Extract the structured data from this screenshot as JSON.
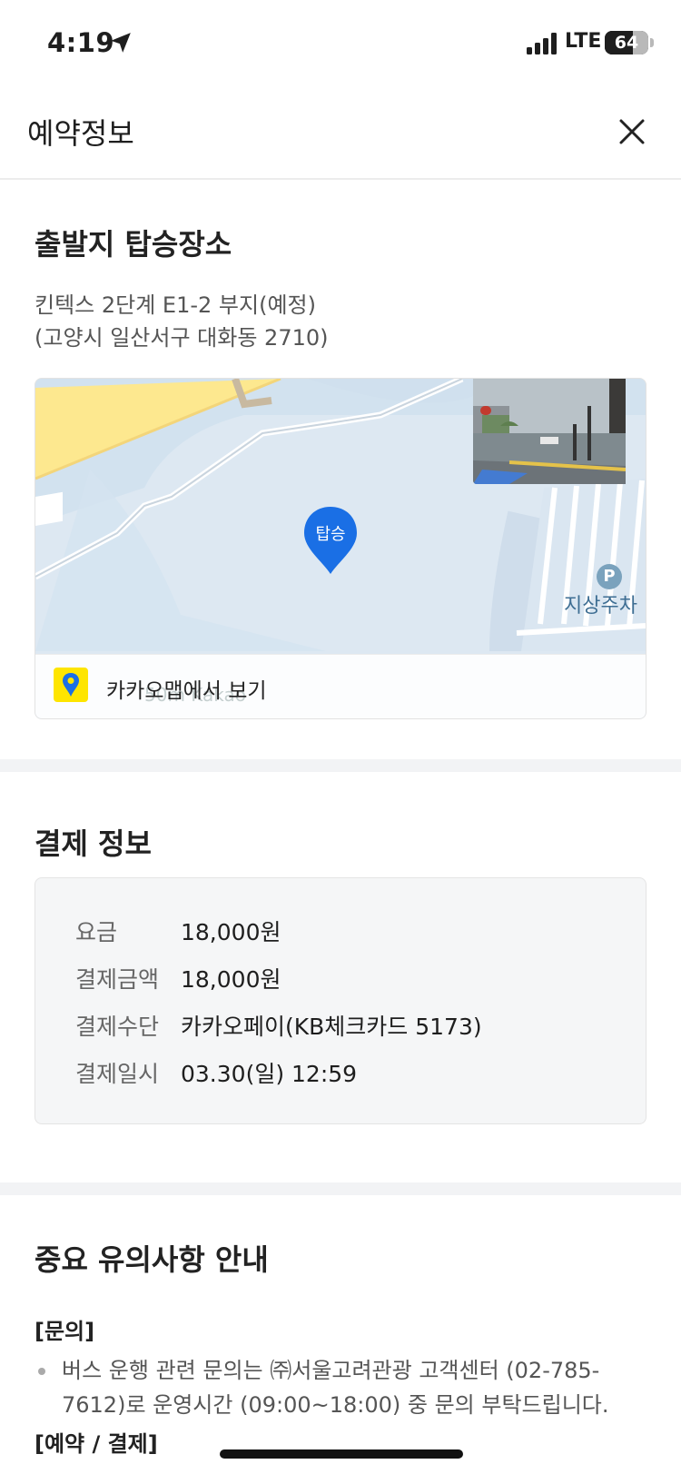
{
  "status_bar": {
    "time": "4:19",
    "network": "LTE",
    "battery": "64",
    "battery_level": 0.64
  },
  "header": {
    "title": "예약정보"
  },
  "departure": {
    "title": "출발지 탑승장소",
    "address_line1": "킨텍스 2단계 E1-2 부지(예정)",
    "address_line2": "(고양시 일산서구 대화동 2710)"
  },
  "map": {
    "pin_label": "탑승",
    "parking_label": "지상주차",
    "parking_symbol": "P",
    "open_link_label": "카카오맵에서 보기",
    "scale_text": "50m  Kakao"
  },
  "payment": {
    "title": "결제 정보",
    "rows": [
      {
        "key": "요금",
        "value": "18,000원"
      },
      {
        "key": "결제금액",
        "value": "18,000원"
      },
      {
        "key": "결제수단",
        "value": "카카오페이(KB체크카드 5173)"
      },
      {
        "key": "결제일시",
        "value": "03.30(일) 12:59"
      }
    ]
  },
  "notice": {
    "title": "중요 유의사항 안내",
    "inquiry_heading": "[문의]",
    "inquiry_text": "버스 운행 관련 문의는 ㈜서울고려관광 고객센터 (02-785-7612)로 운영시간 (09:00~18:00) 중 문의 부탁드립니다.",
    "booking_heading": "[예약 / 결제]"
  },
  "colors": {
    "accent_blue": "#1a6fe5",
    "kakao_yellow": "#fee500"
  }
}
